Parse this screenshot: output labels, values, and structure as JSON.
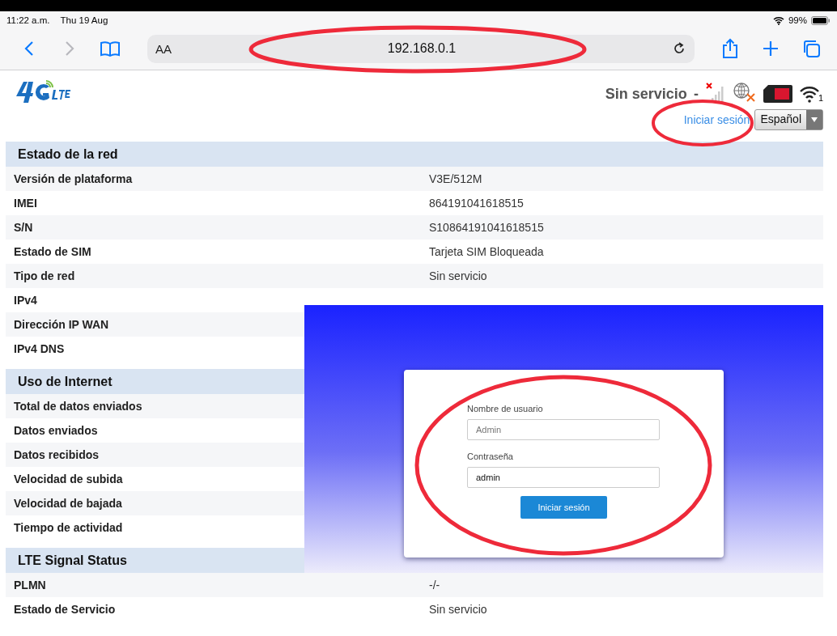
{
  "status_bar": {
    "time": "11:22 a.m.",
    "date": "Thu 19 Aug",
    "battery": "99%"
  },
  "browser": {
    "text_size": "AA",
    "address": "192.168.0.1"
  },
  "router_header": {
    "status": "Sin servicio",
    "separator": "-",
    "wifi_clients": "1",
    "login_link": "Iniciar sesión",
    "language": "Español"
  },
  "sections": [
    {
      "title": "Estado de la red",
      "rows": [
        {
          "label": "Versión de plataforma",
          "value": "V3E/512M"
        },
        {
          "label": "IMEI",
          "value": "864191041618515"
        },
        {
          "label": "S/N",
          "value": "S10864191041618515"
        },
        {
          "label": "Estado de SIM",
          "value": "Tarjeta SIM Bloqueada"
        },
        {
          "label": "Tipo de red",
          "value": "Sin servicio"
        },
        {
          "label": "IPv4"
        },
        {
          "label": "Dirección IP WAN"
        },
        {
          "label": "IPv4 DNS"
        }
      ]
    },
    {
      "title": "Uso de Internet",
      "rows": [
        {
          "label": "Total de datos enviados"
        },
        {
          "label": "Datos enviados"
        },
        {
          "label": "Datos recibidos"
        },
        {
          "label": "Velocidad de subida"
        },
        {
          "label": "Velocidad de bajada"
        },
        {
          "label": "Tiempo de actividad"
        }
      ]
    },
    {
      "title": "LTE Signal Status",
      "rows": [
        {
          "label": "PLMN",
          "value": "-/-"
        },
        {
          "label": "Estado de Servicio",
          "value": "Sin servicio"
        }
      ]
    }
  ],
  "login_dialog": {
    "username_label": "Nombre de usuario",
    "username_placeholder": "Admin",
    "password_label": "Contraseña",
    "password_value": "admin",
    "button": "Iniciar sesión"
  }
}
